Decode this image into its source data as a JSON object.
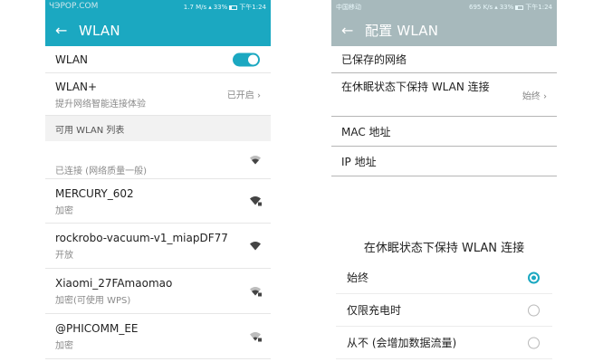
{
  "watermark": "ЧЭРОР.СОМ",
  "left": {
    "status": {
      "speed": "1.7 M/s",
      "battery": "33%",
      "time": "下午1:24"
    },
    "appbar": {
      "back": "←",
      "title": "WLAN"
    },
    "wlan_label": "WLAN",
    "wlan_plus": {
      "title": "WLAN+",
      "sub": "提升网络智能连接体验",
      "value": "已开启 ›"
    },
    "section": "可用 WLAN 列表",
    "networks": [
      {
        "name": "",
        "status": "已连接 (网络质量一般)",
        "locked": false
      },
      {
        "name": "MERCURY_602",
        "status": "加密",
        "locked": true
      },
      {
        "name": "rockrobo-vacuum-v1_miapDF77",
        "status": "开放",
        "locked": false
      },
      {
        "name": "Xiaomi_27FAmaomao",
        "status": "加密(可使用 WPS)",
        "locked": true
      },
      {
        "name": "@PHICOMM_EE",
        "status": "加密",
        "locked": true
      }
    ],
    "wifi_icon": "wifi-signal-icon"
  },
  "right": {
    "status": {
      "carrier": "中国移动",
      "speed": "695 K/s",
      "battery": "33%",
      "time": "下午1:24"
    },
    "appbar": {
      "back": "←",
      "title": "配置 WLAN"
    },
    "items": [
      {
        "label": "已保存的网络",
        "value": ""
      },
      {
        "label": "在休眠状态下保持 WLAN 连接",
        "value": "始终 ›"
      },
      {
        "label": "MAC 地址",
        "value": ""
      },
      {
        "label": "IP 地址",
        "value": ""
      }
    ],
    "dialog": {
      "title": "在休眠状态下保持 WLAN 连接",
      "options": [
        {
          "label": "始终",
          "checked": true
        },
        {
          "label": "仅限充电时",
          "checked": false
        },
        {
          "label": "从不 (会增加数据流量)",
          "checked": false
        }
      ]
    }
  },
  "colors": {
    "accent": "#1ba8c1",
    "dim_overlay": "#c4c4c4"
  }
}
